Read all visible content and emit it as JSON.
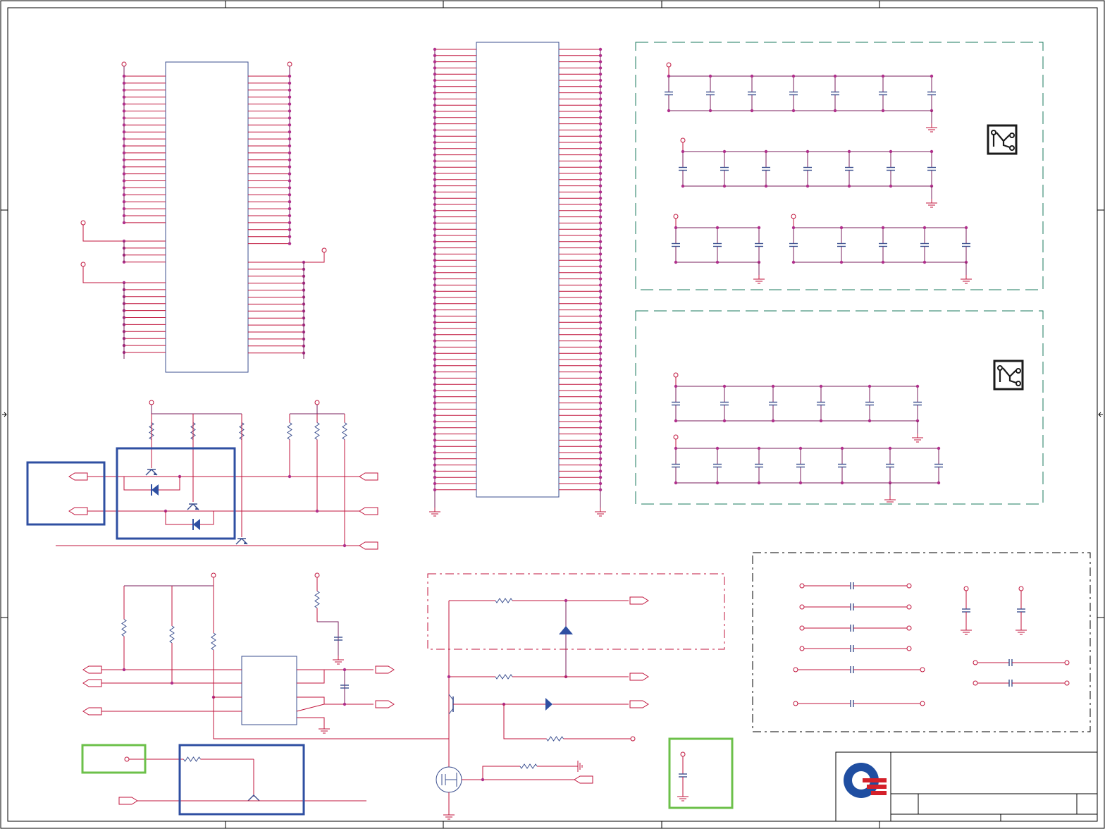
{
  "sheet": {
    "colors": {
      "wire": "#c0143c",
      "net": "#7a1f5c",
      "component_outline": "#3b4f8f",
      "junction": "#b0308c",
      "highlight_blue": "#2f4fa2",
      "highlight_green": "#6cc04a",
      "group_dashed": "#1a7a5e",
      "group_dashdot": "#c0143c",
      "frame": "#000000",
      "logo_blue": "#1f4ea1",
      "logo_red": "#d4202a"
    },
    "icons": [
      "pcb-trace-icon",
      "company-logo-icon",
      "ground-symbol-icon",
      "capacitor-symbol",
      "resistor-symbol",
      "transistor-symbol",
      "diode-symbol",
      "mosfet-symbol"
    ],
    "labels_visible": false
  }
}
